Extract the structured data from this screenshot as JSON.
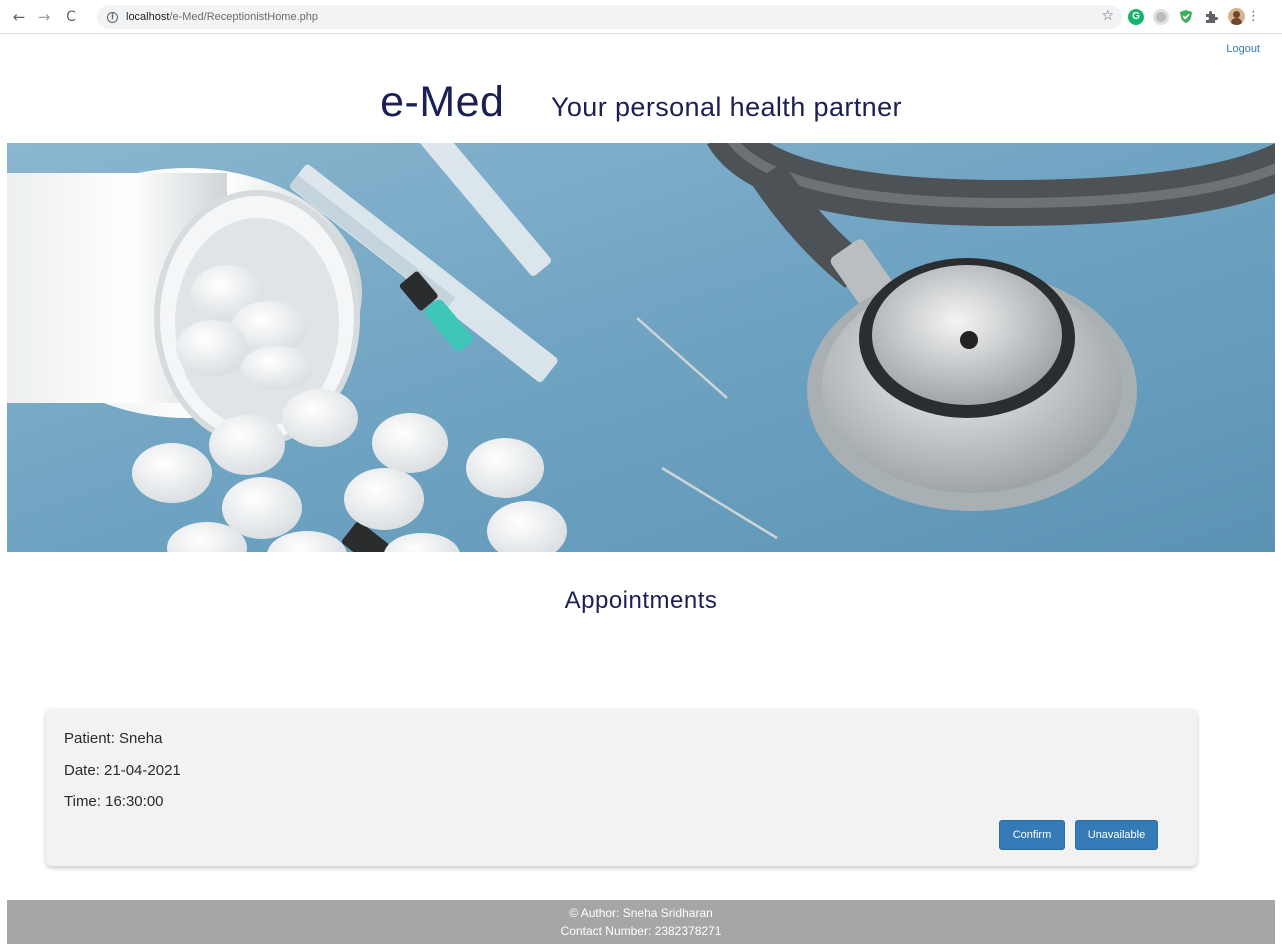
{
  "browser": {
    "back_icon": "←",
    "forward_icon": "→",
    "reload_icon": "C",
    "info_icon": "i",
    "url_host": "localhost",
    "url_path": "/e-Med/ReceptionistHome.php",
    "star_icon": "☆",
    "extension_g_label": "G",
    "menu_icon": "⋮"
  },
  "header": {
    "logout_label": "Logout",
    "title": "e-Med",
    "tagline": "Your personal health partner"
  },
  "section": {
    "title": "Appointments"
  },
  "appointment": {
    "patient": "Patient: Sneha",
    "date": "Date: 21-04-2021",
    "time": "Time: 16:30:00",
    "confirm_label": "Confirm",
    "unavailable_label": "Unavailable"
  },
  "footer": {
    "author": "© Author: Sneha Sridharan",
    "contact": "Contact Number: 2382378271"
  },
  "colors": {
    "brand_navy": "#1c1f54",
    "button_blue": "#337ab7",
    "footer_grey": "#a6a6a6",
    "card_bg": "#f2f2f2"
  }
}
